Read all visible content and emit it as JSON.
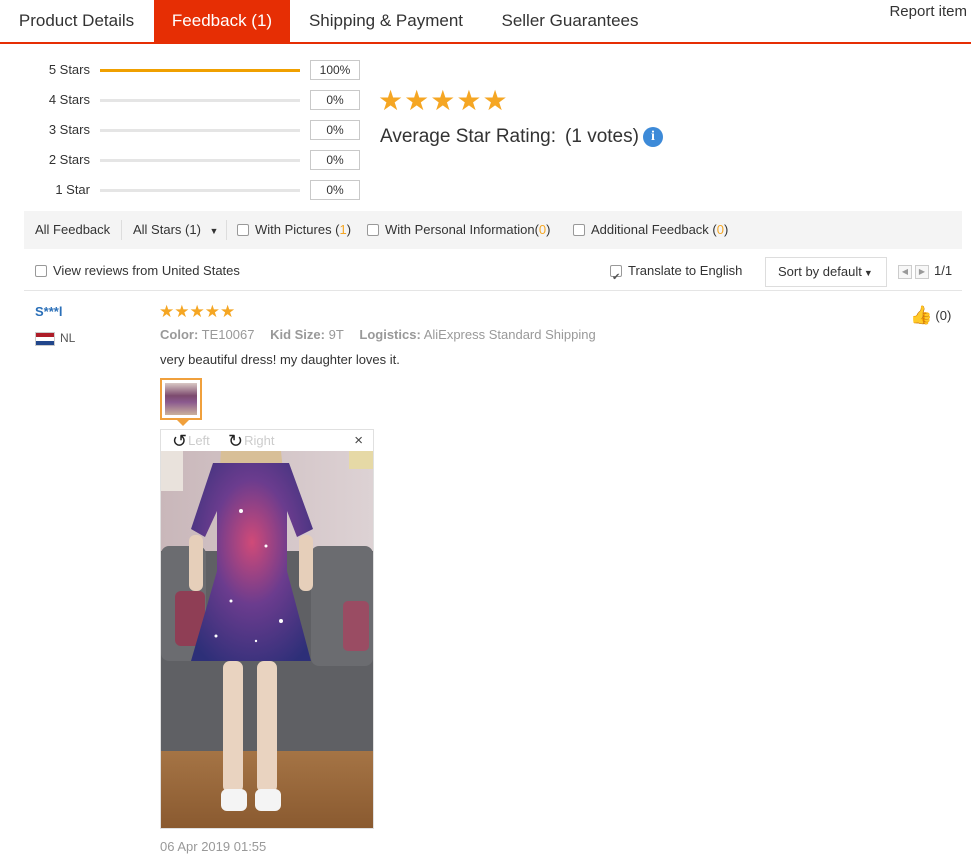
{
  "tabs": [
    {
      "label": "Product Details",
      "active": false
    },
    {
      "label": "Feedback (1)",
      "active": true
    },
    {
      "label": "Shipping & Payment",
      "active": false
    },
    {
      "label": "Seller Guarantees",
      "active": false
    }
  ],
  "report_label": "Report item",
  "histogram": [
    {
      "label": "5 Stars",
      "percent": "100%",
      "fraction": 1.0
    },
    {
      "label": "4 Stars",
      "percent": "0%",
      "fraction": 0
    },
    {
      "label": "3 Stars",
      "percent": "0%",
      "fraction": 0
    },
    {
      "label": "2 Stars",
      "percent": "0%",
      "fraction": 0
    },
    {
      "label": "1 Star",
      "percent": "0%",
      "fraction": 0
    }
  ],
  "average": {
    "stars": 5,
    "label": "Average Star Rating:",
    "votes": "(1 votes)",
    "info_icon": "info-icon"
  },
  "filters": {
    "all_feedback": "All Feedback",
    "all_stars": "All Stars (1)",
    "with_pictures": {
      "label": "With Pictures (",
      "count": "1",
      "close": ")"
    },
    "with_personal": {
      "label": "With Personal Information(",
      "count": "0",
      "close": ")"
    },
    "additional": {
      "label": "Additional Feedback (",
      "count": "0",
      "close": ")"
    }
  },
  "options": {
    "view_us": "View reviews from United States",
    "view_us_checked": false,
    "translate": "Translate to English",
    "translate_checked": true,
    "sort": "Sort by default",
    "page": "1/1"
  },
  "review": {
    "user": "S***l",
    "country": "NL",
    "stars": 5,
    "color_label": "Color:",
    "color_value": "TE10067",
    "size_label": "Kid Size:",
    "size_value": "9T",
    "logistics_label": "Logistics:",
    "logistics_value": "AliExpress Standard Shipping",
    "text": "very beautiful dress! my daughter loves it.",
    "viewer": {
      "left": "Left",
      "right": "Right",
      "close": "×"
    },
    "likes": "(0)",
    "date": "06 Apr 2019 01:55"
  },
  "colors": {
    "accent": "#e62e04",
    "star": "#f5a623",
    "link": "#2a6fb8"
  }
}
